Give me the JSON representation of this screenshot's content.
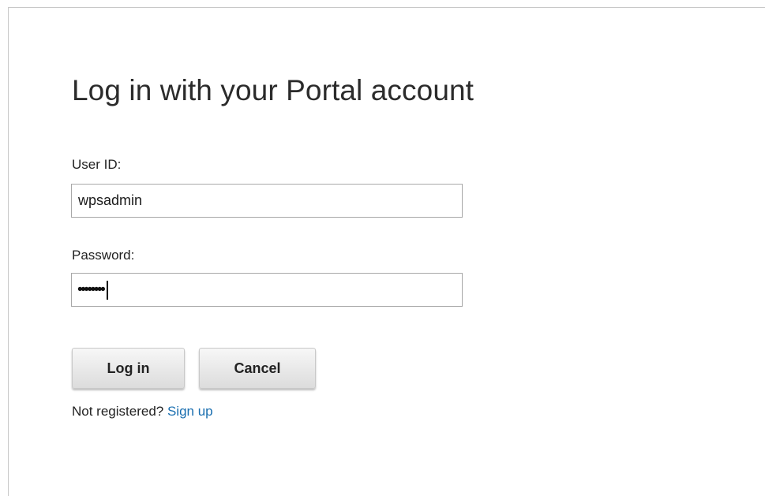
{
  "login": {
    "title": "Log in with your Portal account",
    "user_label": "User ID:",
    "user_value": "wpsadmin",
    "password_label": "Password:",
    "password_masked": "••••••••",
    "login_button": "Log in",
    "cancel_button": "Cancel",
    "not_registered": "Not registered?",
    "signup_link": "Sign up"
  },
  "colors": {
    "link": "#1a6fb0",
    "border": "#a8a8a8"
  }
}
